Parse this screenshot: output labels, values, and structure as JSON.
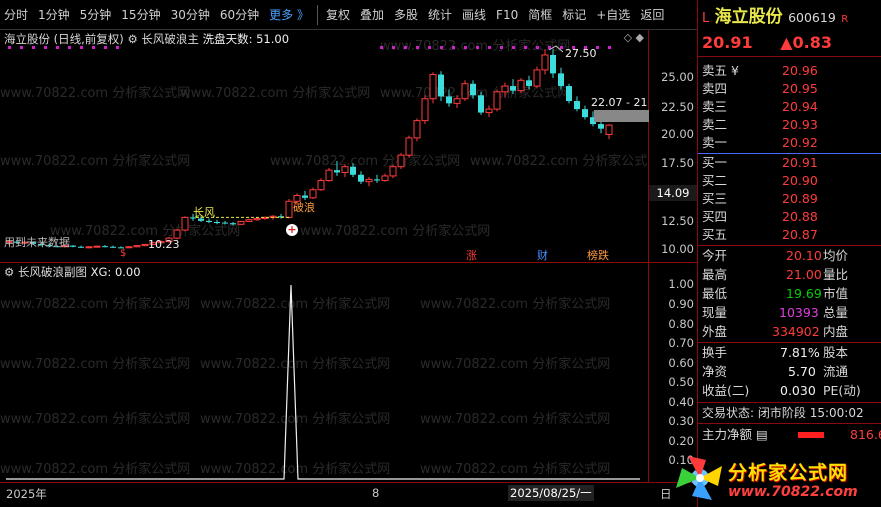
{
  "toolbar": {
    "items": [
      "分时",
      "1分钟",
      "5分钟",
      "15分钟",
      "30分钟",
      "60分钟",
      "更多 》"
    ],
    "tools": [
      "复权",
      "叠加",
      "多股",
      "统计",
      "画线",
      "F10",
      "简框",
      "标记",
      "+自选",
      "返回"
    ]
  },
  "main": {
    "title_stock": "海立股份",
    "title_mode": "(日线,前复权)",
    "indicator_name": "长风破浪主",
    "indicator_param": "洗盘天数: 51.00",
    "high_label": "27.50",
    "low_label": "10.23",
    "range_label": "22.07 - 21",
    "current_price_tag": "14.09",
    "note_future": "用到未来数据",
    "tag_changfeng": "长风",
    "tag_polang": "破浪",
    "event_zhang": "涨",
    "event_cai": "财",
    "event_bang": "榜跌",
    "event_s": "$",
    "y_ticks": [
      "25.00",
      "22.50",
      "20.00",
      "17.50",
      "12.50",
      "10.00"
    ]
  },
  "sub": {
    "title": "长风破浪副图",
    "value": "XG: 0.00",
    "y_ticks": [
      "1.00",
      "0.90",
      "0.80",
      "0.70",
      "0.60",
      "0.50",
      "0.40",
      "0.30",
      "0.20",
      "0.10"
    ]
  },
  "dates": {
    "start": "2025年",
    "mid": "8",
    "cursor": "2025/08/25/一",
    "end": "日"
  },
  "quote": {
    "flag": "L",
    "name": "海立股份",
    "code": "600619",
    "r_flag": "R",
    "price": "20.91",
    "change": "▲0.83",
    "asks": [
      {
        "label": "卖五 ¥",
        "price": "20.96"
      },
      {
        "label": "卖四",
        "price": "20.95"
      },
      {
        "label": "卖三",
        "price": "20.94"
      },
      {
        "label": "卖二",
        "price": "20.93"
      },
      {
        "label": "卖一",
        "price": "20.92"
      }
    ],
    "bids": [
      {
        "label": "买一",
        "price": "20.91"
      },
      {
        "label": "买二",
        "price": "20.90"
      },
      {
        "label": "买三",
        "price": "20.89"
      },
      {
        "label": "买四",
        "price": "20.88"
      },
      {
        "label": "买五",
        "price": "20.87"
      }
    ],
    "stats": [
      {
        "l": "今开",
        "v": "20.10",
        "l2": "均价"
      },
      {
        "l": "最高",
        "v": "21.00",
        "l2": "量比"
      },
      {
        "l": "最低",
        "v": "19.69",
        "l2": "市值"
      },
      {
        "l": "现量",
        "v": "10393",
        "l2": "总量"
      },
      {
        "l": "外盘",
        "v": "334902",
        "l2": "内盘"
      }
    ],
    "stats2": [
      {
        "l": "换手",
        "v": "7.81%",
        "l2": "股本"
      },
      {
        "l": "净资",
        "v": "5.70",
        "l2": "流通"
      },
      {
        "l": "收益(二)",
        "v": "0.030",
        "l2": "PE(动)"
      }
    ],
    "trade_state_label": "交易状态:",
    "trade_state": "闭市阶段",
    "trade_time": "15:00:02",
    "net_label": "主力净额",
    "net_value": "816.6"
  },
  "watermark": "www.70822.com 分析家公式网",
  "logo": {
    "title": "分析家公式网",
    "url": "www.70822.com"
  },
  "colors": {
    "up": "#ff3c3c",
    "down": "#3cdcdc",
    "accent": "#e8e84a"
  }
}
